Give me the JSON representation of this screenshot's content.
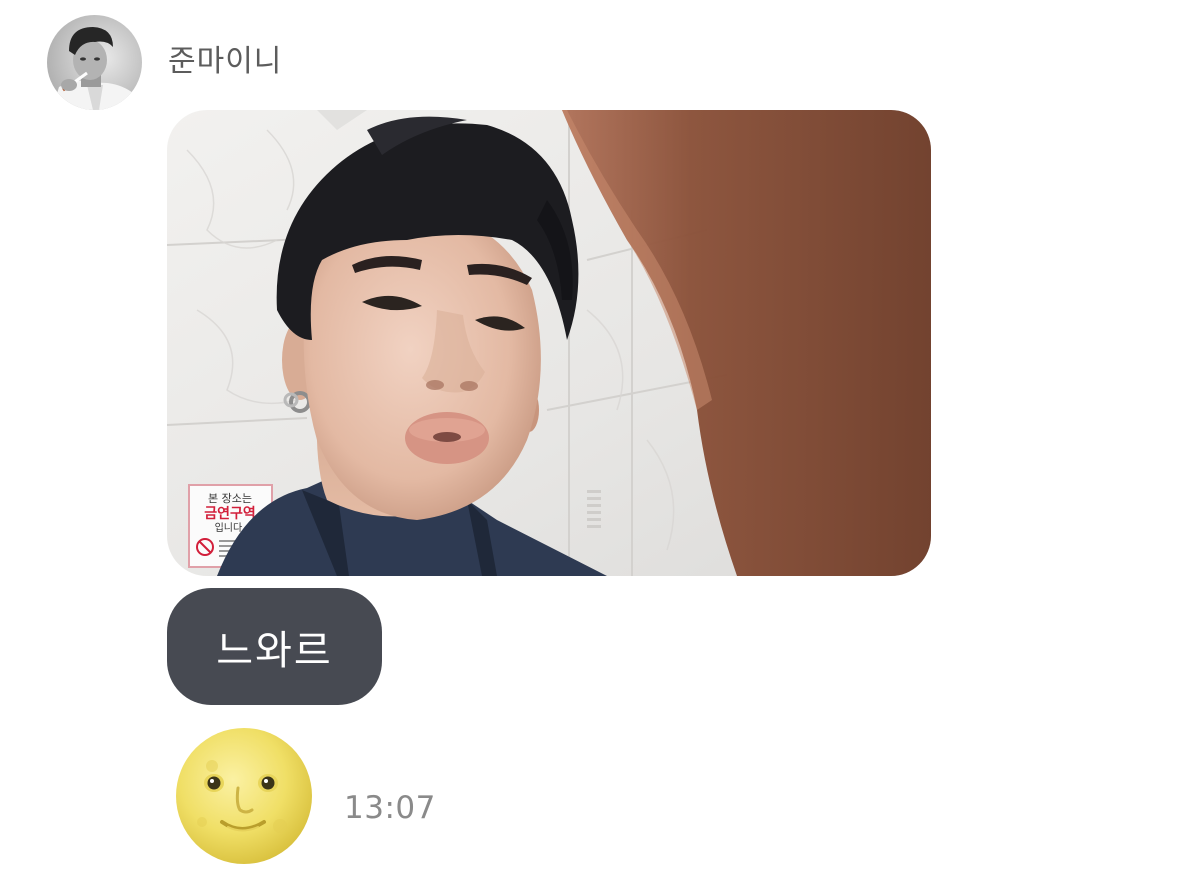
{
  "message": {
    "sender": {
      "name": "준마이니",
      "avatar_icon": "profile-photo"
    },
    "photo": {
      "icon": "selfie-photo",
      "sign_text": [
        "본 장소는",
        "금연구역",
        "입니다."
      ],
      "sign_color": "#d21f3a"
    },
    "text": "느와르",
    "emoji": {
      "icon": "full-moon-face-emoji",
      "color": "#f2e270"
    },
    "timestamp": "13:07"
  },
  "colors": {
    "bubble": "#474a52",
    "bubble_text": "#ffffff",
    "name": "#5c5c5c",
    "timestamp": "#8a8a8a"
  }
}
